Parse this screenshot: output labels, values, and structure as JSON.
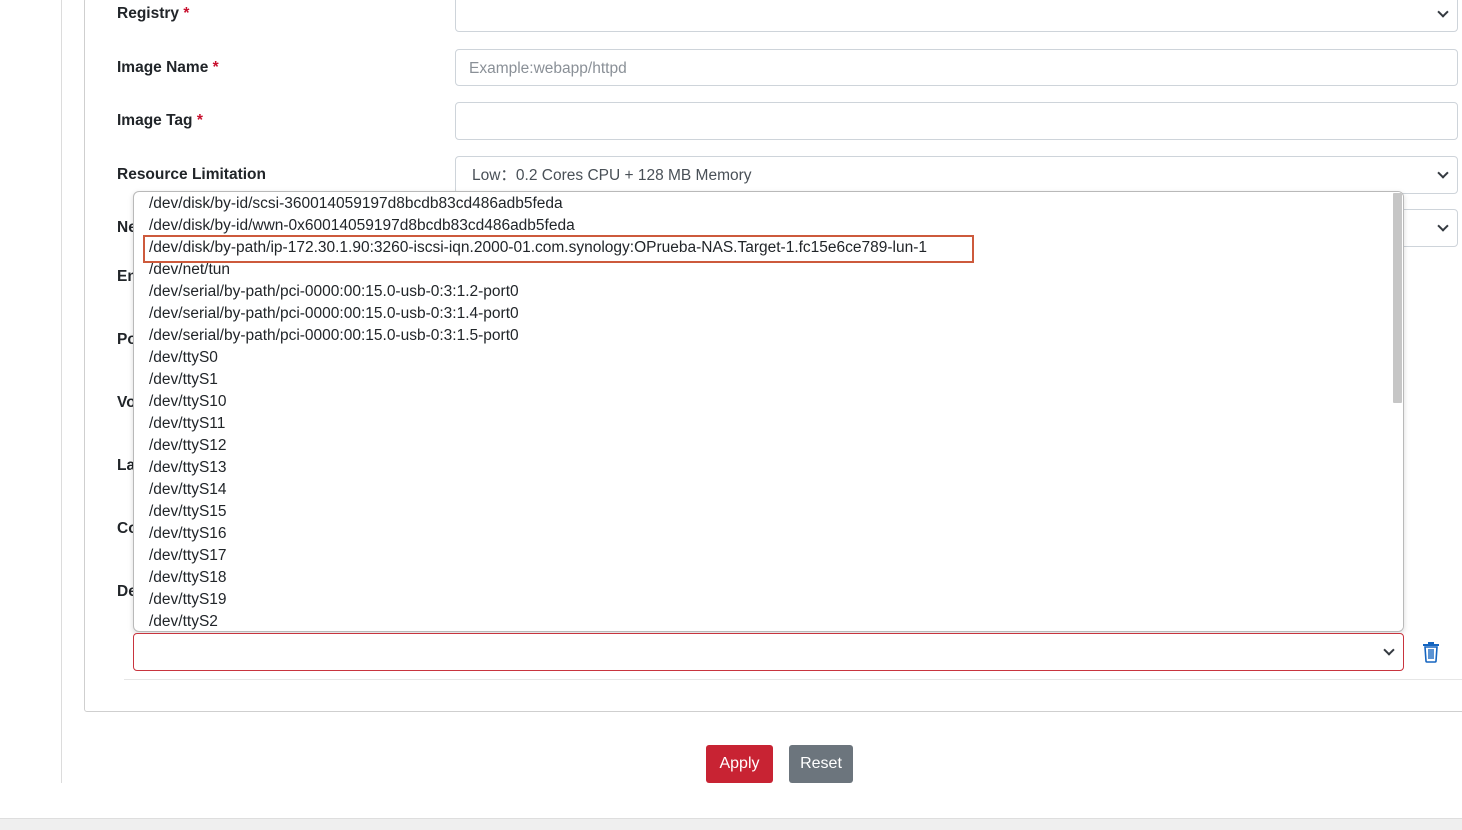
{
  "form": {
    "registry": {
      "label": "Registry",
      "required_mark": "*",
      "value": ""
    },
    "image_name": {
      "label": "Image Name",
      "required_mark": "*",
      "placeholder": "Example:webapp/httpd",
      "value": ""
    },
    "image_tag": {
      "label": "Image Tag",
      "required_mark": "*",
      "value": ""
    },
    "resource_limitation": {
      "label": "Resource Limitation",
      "value": "Low：0.2 Cores CPU + 128 MB Memory"
    },
    "cut_labels": [
      "Ne",
      "En",
      "Po",
      "Vo",
      "La",
      "Co",
      "De"
    ]
  },
  "device_dropdown": {
    "options": [
      "/dev/disk/by-id/scsi-360014059197d8bcdb83cd486adb5feda",
      "/dev/disk/by-id/wwn-0x60014059197d8bcdb83cd486adb5feda",
      "/dev/disk/by-path/ip-172.30.1.90:3260-iscsi-iqn.2000-01.com.synology:OPrueba-NAS.Target-1.fc15e6ce789-lun-1",
      "/dev/net/tun",
      "/dev/serial/by-path/pci-0000:00:15.0-usb-0:3:1.2-port0",
      "/dev/serial/by-path/pci-0000:00:15.0-usb-0:3:1.4-port0",
      "/dev/serial/by-path/pci-0000:00:15.0-usb-0:3:1.5-port0",
      "/dev/ttyS0",
      "/dev/ttyS1",
      "/dev/ttyS10",
      "/dev/ttyS11",
      "/dev/ttyS12",
      "/dev/ttyS13",
      "/dev/ttyS14",
      "/dev/ttyS15",
      "/dev/ttyS16",
      "/dev/ttyS17",
      "/dev/ttyS18",
      "/dev/ttyS19",
      "/dev/ttyS2"
    ],
    "highlighted_index": 2,
    "selected_value": ""
  },
  "actions": {
    "apply_label": "Apply",
    "reset_label": "Reset"
  },
  "colors": {
    "apply": "#c82333",
    "reset": "#6c757d",
    "required": "#c8102e",
    "highlight": "#cd5a3c",
    "invalid_border": "#c8343e",
    "trash_icon": "#1565c0"
  },
  "icons": {
    "select_arrow": "chevron-down-icon",
    "delete": "trash-icon"
  }
}
